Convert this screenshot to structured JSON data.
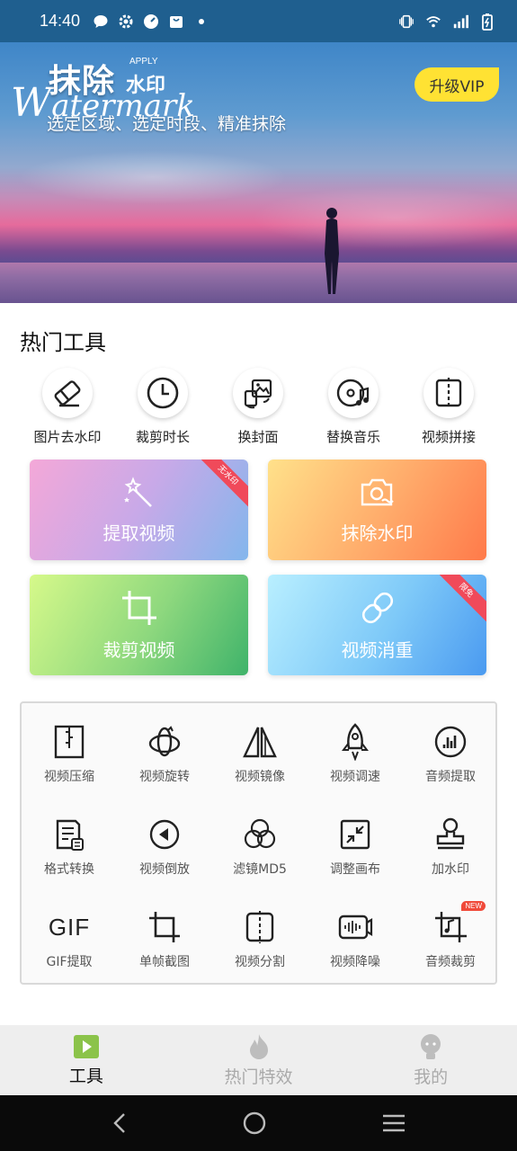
{
  "status_bar": {
    "time": "14:40"
  },
  "banner": {
    "title": "抹除",
    "title2": "水印",
    "apply": "APPLY",
    "watermark_big": "W",
    "watermark_rest": "atermark",
    "subtitle": "选定区域、选定时段、精准抹除",
    "vip_label": "升级VIP"
  },
  "hot_tools": {
    "title": "热门工具",
    "items": [
      {
        "label": "图片去水印",
        "icon": "eraser-icon"
      },
      {
        "label": "裁剪时长",
        "icon": "clock-icon"
      },
      {
        "label": "换封面",
        "icon": "image-swap-icon"
      },
      {
        "label": "替换音乐",
        "icon": "music-disc-icon"
      },
      {
        "label": "视频拼接",
        "icon": "split-join-icon"
      }
    ]
  },
  "feature_cards": [
    {
      "label": "提取视频",
      "ribbon": "无水印",
      "icon": "magic-wand-icon"
    },
    {
      "label": "抹除水印",
      "icon": "camera-wave-icon"
    },
    {
      "label": "裁剪视频",
      "icon": "crop-icon"
    },
    {
      "label": "视频消重",
      "ribbon": "限免",
      "icon": "link-icon"
    }
  ],
  "tool_grid": {
    "items": [
      {
        "label": "视频压缩",
        "icon": "zip-icon"
      },
      {
        "label": "视频旋转",
        "icon": "rotate-icon"
      },
      {
        "label": "视频镜像",
        "icon": "mirror-icon"
      },
      {
        "label": "视频调速",
        "icon": "rocket-icon"
      },
      {
        "label": "音频提取",
        "icon": "audio-bars-icon"
      },
      {
        "label": "格式转换",
        "icon": "format-icon"
      },
      {
        "label": "视频倒放",
        "icon": "reverse-play-icon"
      },
      {
        "label": "滤镜MD5",
        "icon": "filter-circles-icon"
      },
      {
        "label": "调整画布",
        "icon": "shrink-icon"
      },
      {
        "label": "加水印",
        "icon": "stamp-icon"
      },
      {
        "label": "GIF提取",
        "icon": "gif-icon",
        "icon_text": "GIF"
      },
      {
        "label": "单帧截图",
        "icon": "frame-crop-icon"
      },
      {
        "label": "视频分割",
        "icon": "split-icon"
      },
      {
        "label": "视频降噪",
        "icon": "denoise-icon"
      },
      {
        "label": "音频裁剪",
        "icon": "audio-crop-icon",
        "badge": "NEW"
      }
    ]
  },
  "tab_bar": {
    "tabs": [
      {
        "label": "工具",
        "active": true
      },
      {
        "label": "热门特效",
        "active": false
      },
      {
        "label": "我的",
        "active": false
      }
    ]
  },
  "colors": {
    "accent_green": "#8bc34a",
    "vip_yellow": "#ffe233",
    "ribbon_red": "#f04a5a"
  }
}
